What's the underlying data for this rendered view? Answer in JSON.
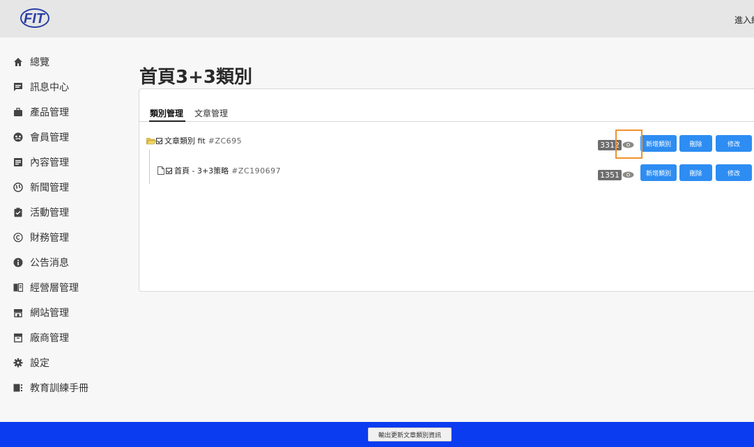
{
  "header": {
    "logo": "FIT",
    "enter_link": "進入網站"
  },
  "sidebar": {
    "items": [
      {
        "label": "總覽",
        "icon": "home-icon"
      },
      {
        "label": "訊息中心",
        "icon": "message-icon"
      },
      {
        "label": "產品管理",
        "icon": "briefcase-icon"
      },
      {
        "label": "會員管理",
        "icon": "member-icon"
      },
      {
        "label": "內容管理",
        "icon": "content-icon"
      },
      {
        "label": "新聞管理",
        "icon": "globe-icon"
      },
      {
        "label": "活動管理",
        "icon": "clipboard-check-icon"
      },
      {
        "label": "財務管理",
        "icon": "copyright-icon"
      },
      {
        "label": "公告消息",
        "icon": "info-icon"
      },
      {
        "label": "經營層管理",
        "icon": "book-icon"
      },
      {
        "label": "網站管理",
        "icon": "store-icon"
      },
      {
        "label": "廠商管理",
        "icon": "archive-icon"
      },
      {
        "label": "設定",
        "icon": "gear-icon"
      },
      {
        "label": "教育訓練手冊",
        "icon": "manual-icon"
      }
    ]
  },
  "main": {
    "title": "首頁3+3類別",
    "tabs": [
      {
        "label": "類別管理",
        "active": true
      },
      {
        "label": "文章管理",
        "active": false
      }
    ],
    "tree": [
      {
        "label": "文章類別 fit",
        "code": "#ZC695",
        "count": "3312",
        "icon": "folder-open-icon"
      },
      {
        "label": "首頁 - 3+3策略",
        "code": "#ZC190697",
        "count": "1351",
        "icon": "file-icon"
      }
    ],
    "row_buttons": {
      "add": "新增類別",
      "delete": "刪除",
      "edit": "修改"
    }
  },
  "footer": {
    "export_label": "輸出更新文章類別資訊"
  },
  "colors": {
    "primary_button": "#2d8df2",
    "footer_bar": "#0b3cf0",
    "highlight": "#f0922d"
  }
}
